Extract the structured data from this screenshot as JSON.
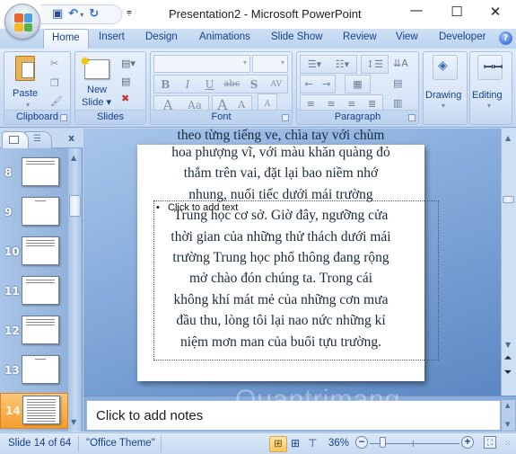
{
  "window": {
    "title": "Presentation2 - Microsoft PowerPoint",
    "minimize": "—",
    "maximize": "☐",
    "close": "✕"
  },
  "qat": {
    "save_icon": "💾",
    "undo_icon": "↶",
    "undo_dropdown": "▾",
    "redo_icon": "↻",
    "customize": "⩦"
  },
  "tabs": [
    {
      "label": "Home",
      "active": true
    },
    {
      "label": "Insert"
    },
    {
      "label": "Design"
    },
    {
      "label": "Animations"
    },
    {
      "label": "Slide Show"
    },
    {
      "label": "Review"
    },
    {
      "label": "View"
    },
    {
      "label": "Developer"
    }
  ],
  "help_icon": "?",
  "ribbon": {
    "clipboard": {
      "label": "Clipboard",
      "paste": "Paste",
      "paste_arrow": "▾"
    },
    "slides": {
      "label": "Slides",
      "new_slide_line1": "New",
      "new_slide_line2": "Slide ▾"
    },
    "font": {
      "label": "Font",
      "font_name": "",
      "font_size": "",
      "bold": "B",
      "italic": "I",
      "underline": "U",
      "strike": "abc",
      "shadow": "S",
      "spacing": "AV",
      "color": "A",
      "case": "Aa",
      "grow": "A",
      "shrink": "A",
      "clear": "A"
    },
    "paragraph": {
      "label": "Paragraph"
    },
    "drawing": {
      "label": "Drawing",
      "arrow": "▾"
    },
    "editing": {
      "label": "Editing",
      "arrow": "▾"
    }
  },
  "slides_pane": {
    "close": "x",
    "thumbnails": [
      {
        "number": "8",
        "lines": 2,
        "active": false
      },
      {
        "number": "9",
        "lines": 1,
        "active": false
      },
      {
        "number": "10",
        "lines": 3,
        "active": false
      },
      {
        "number": "11",
        "lines": 2,
        "active": false
      },
      {
        "number": "12",
        "lines": 3,
        "active": false
      },
      {
        "number": "13",
        "lines": 1,
        "active": false
      },
      {
        "number": "14",
        "lines": 9,
        "active": true
      }
    ]
  },
  "slide": {
    "overflow_line": "theo từng tiếng ve, chìa tay với chùm",
    "lines": [
      "hoa phượng vĩ, với màu khăn quàng đỏ",
      "thắm trên vai, đặt lại bao niềm nhớ",
      "nhung, nuối tiếc dưới mái trường",
      "Trung học cơ sở. Giờ đây, ngưỡng cửa",
      "thời gian của những thử thách dưới mái",
      "trường Trung học phổ thông đang rộng",
      "mở chào đón chúng ta. Trong cái",
      "không khí mát mẻ của những cơn mưa",
      "đầu thu, lòng tôi lại nao nức những kỉ",
      "niệm mơn man của buổi tựu trường."
    ],
    "placeholder": "Click to add text",
    "placeholder_bullet": "•"
  },
  "notes": {
    "placeholder": "Click to add notes"
  },
  "status": {
    "slide_info": "Slide 14 of 64",
    "theme": "\"Office Theme\"",
    "zoom": "36%",
    "zoom_level_percent": 36,
    "zoom_minus": "−",
    "zoom_plus": "+"
  },
  "watermark": "Quantrimang"
}
